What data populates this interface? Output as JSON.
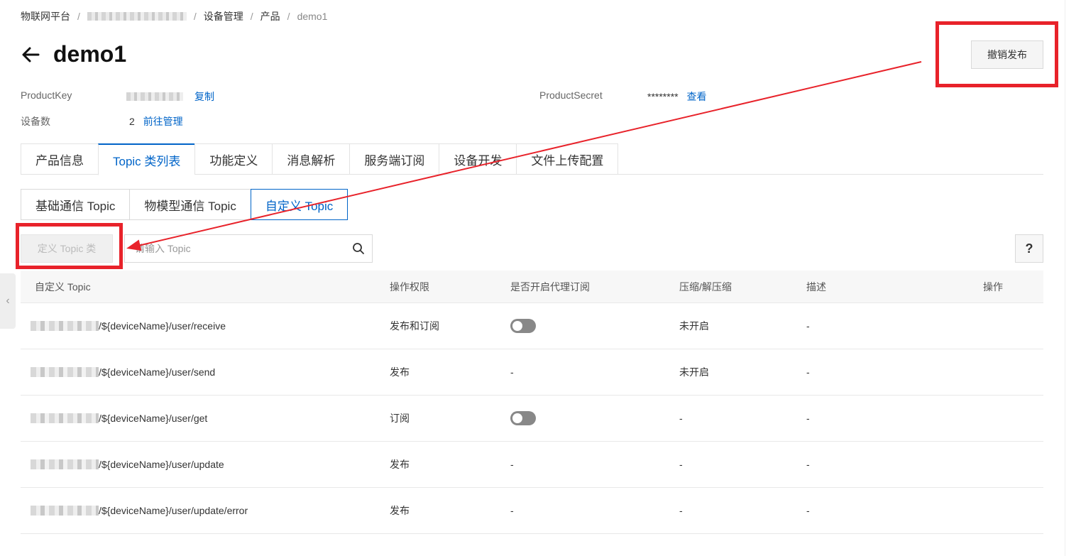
{
  "breadcrumb": {
    "root": "物联网平台",
    "instance_label": "",
    "device_mgmt": "设备管理",
    "product": "产品",
    "current": "demo1"
  },
  "header": {
    "title": "demo1",
    "revoke_button": "撤销发布"
  },
  "info": {
    "product_key_label": "ProductKey",
    "copy_link": "复制",
    "product_secret_label": "ProductSecret",
    "product_secret_value": "********",
    "view_link": "查看",
    "device_count_label": "设备数",
    "device_count_value": "2",
    "manage_link": "前往管理"
  },
  "main_tabs": [
    {
      "label": "产品信息"
    },
    {
      "label": "Topic 类列表"
    },
    {
      "label": "功能定义"
    },
    {
      "label": "消息解析"
    },
    {
      "label": "服务端订阅"
    },
    {
      "label": "设备开发"
    },
    {
      "label": "文件上传配置"
    }
  ],
  "sub_tabs": [
    {
      "label": "基础通信 Topic"
    },
    {
      "label": "物模型通信 Topic"
    },
    {
      "label": "自定义 Topic"
    }
  ],
  "toolbar": {
    "define_button": "定义 Topic 类",
    "search_placeholder": "请输入 Topic",
    "help_label": "?"
  },
  "table": {
    "headers": [
      "自定义 Topic",
      "操作权限",
      "是否开启代理订阅",
      "压缩/解压缩",
      "描述",
      "操作"
    ],
    "rows": [
      {
        "topic": "/${deviceName}/user/receive",
        "permission": "发布和订阅",
        "proxy": "toggle",
        "compress": "未开启",
        "desc": "-"
      },
      {
        "topic": "/${deviceName}/user/send",
        "permission": "发布",
        "proxy": "-",
        "compress": "未开启",
        "desc": "-"
      },
      {
        "topic": "/${deviceName}/user/get",
        "permission": "订阅",
        "proxy": "toggle",
        "compress": "-",
        "desc": "-"
      },
      {
        "topic": "/${deviceName}/user/update",
        "permission": "发布",
        "proxy": "-",
        "compress": "-",
        "desc": "-"
      },
      {
        "topic": "/${deviceName}/user/update/error",
        "permission": "发布",
        "proxy": "-",
        "compress": "-",
        "desc": "-"
      }
    ]
  },
  "colors": {
    "accent": "#0064c8",
    "annotation": "#e8222a"
  }
}
